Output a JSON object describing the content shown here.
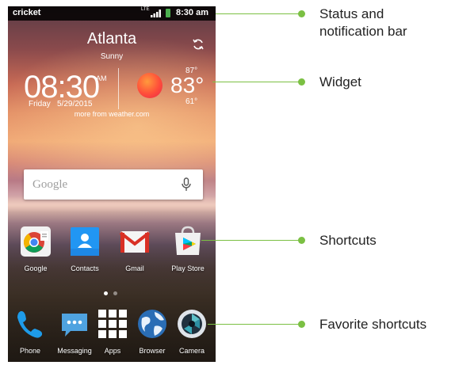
{
  "status_bar": {
    "carrier": "cricket",
    "network": "LTE",
    "time": "8:30 am"
  },
  "weather": {
    "city": "Atlanta",
    "condition": "Sunny",
    "time": "08:30",
    "ampm": "AM",
    "day": "Friday",
    "date": "5/29/2015",
    "temp_high": "87°",
    "temp_now": "83°",
    "temp_low": "61°",
    "more_link": "more from weather.com"
  },
  "search": {
    "logo": "Google"
  },
  "shortcuts": [
    {
      "label": "Google",
      "icon": "chrome-icon"
    },
    {
      "label": "Contacts",
      "icon": "contacts-icon"
    },
    {
      "label": "Gmail",
      "icon": "gmail-icon"
    },
    {
      "label": "Play Store",
      "icon": "play-store-icon"
    }
  ],
  "favorites": [
    {
      "label": "Phone",
      "icon": "phone-icon"
    },
    {
      "label": "Messaging",
      "icon": "messaging-icon"
    },
    {
      "label": "Apps",
      "icon": "apps-grid-icon"
    },
    {
      "label": "Browser",
      "icon": "browser-globe-icon"
    },
    {
      "label": "Camera",
      "icon": "camera-icon"
    }
  ],
  "callouts": {
    "status": "Status and notification bar",
    "status_line1": "Status and",
    "status_line2": "notification bar",
    "widget": "Widget",
    "shortcuts": "Shortcuts",
    "favorites": "Favorite shortcuts"
  },
  "colors": {
    "callout_accent": "#7bc043",
    "battery": "#4caf50"
  }
}
